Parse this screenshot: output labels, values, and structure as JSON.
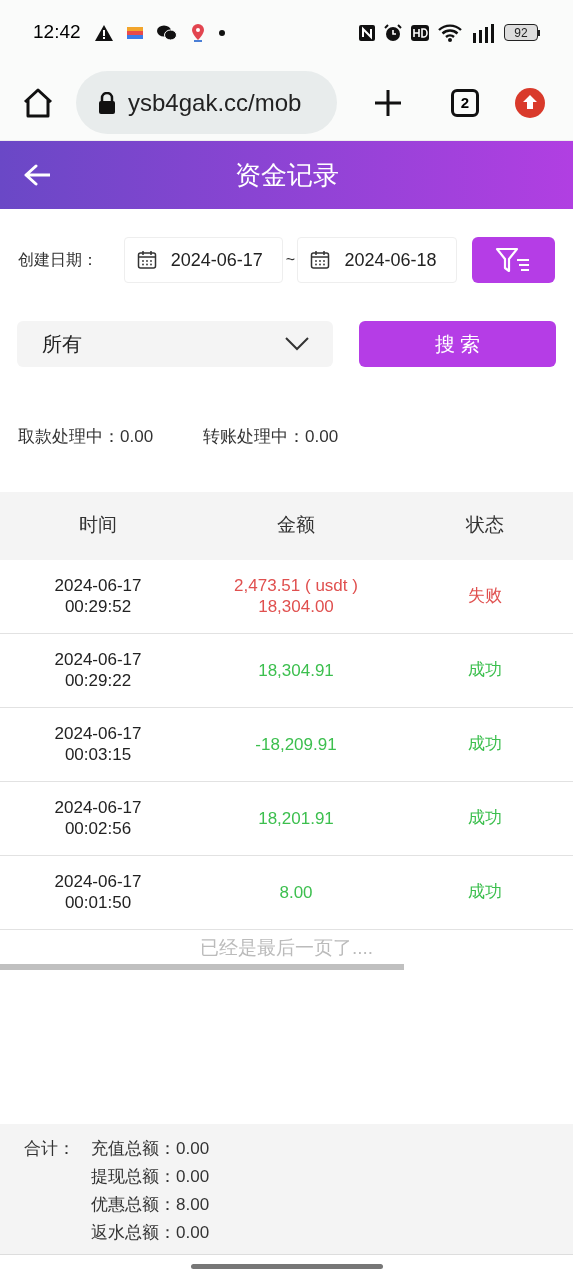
{
  "status_bar": {
    "time": "12:42",
    "battery": "92"
  },
  "browser": {
    "url": "ysb4gak.cc/mob",
    "tab_count": "2"
  },
  "header": {
    "title": "资金记录"
  },
  "filter": {
    "date_label": "创建日期：",
    "start_date": "2024-06-17",
    "separator": "~",
    "end_date": "2024-06-18",
    "type_select": "所有",
    "search_button": "搜 索"
  },
  "processing": [
    {
      "label": "取款处理中：",
      "value": "0.00"
    },
    {
      "label": "转账处理中：",
      "value": "0.00"
    }
  ],
  "table": {
    "columns": [
      "时间",
      "金额",
      "状态"
    ],
    "rows": [
      {
        "date": "2024-06-17",
        "time": "00:29:52",
        "amounts": [
          "2,473.51 ( usdt )",
          "18,304.00"
        ],
        "status": "失败",
        "kind": "failed"
      },
      {
        "date": "2024-06-17",
        "time": "00:29:22",
        "amounts": [
          "18,304.91"
        ],
        "status": "成功",
        "kind": "success"
      },
      {
        "date": "2024-06-17",
        "time": "00:03:15",
        "amounts": [
          "-18,209.91"
        ],
        "status": "成功",
        "kind": "success"
      },
      {
        "date": "2024-06-17",
        "time": "00:02:56",
        "amounts": [
          "18,201.91"
        ],
        "status": "成功",
        "kind": "success"
      },
      {
        "date": "2024-06-17",
        "time": "00:01:50",
        "amounts": [
          "8.00"
        ],
        "status": "成功",
        "kind": "success"
      }
    ]
  },
  "end_message": "已经是最后一页了....",
  "totals": {
    "label": "合计：",
    "items": [
      {
        "label": "充值总额：",
        "value": "0.00"
      },
      {
        "label": "提现总额：",
        "value": "0.00"
      },
      {
        "label": "优惠总额：",
        "value": "8.00"
      },
      {
        "label": "返水总额：",
        "value": "0.00"
      }
    ]
  }
}
